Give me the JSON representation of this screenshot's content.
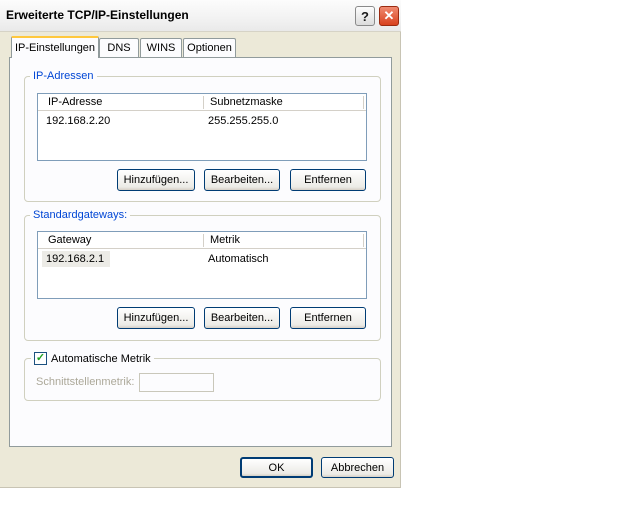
{
  "window": {
    "title": "Erweiterte TCP/IP-Einstellungen",
    "help_label": "?",
    "close_label": "✕"
  },
  "tabs": [
    {
      "label": "IP-Einstellungen",
      "active": true
    },
    {
      "label": "DNS",
      "active": false
    },
    {
      "label": "WINS",
      "active": false
    },
    {
      "label": "Optionen",
      "active": false
    }
  ],
  "ip_group": {
    "legend": "IP-Adressen",
    "columns": [
      "IP-Adresse",
      "Subnetzmaske"
    ],
    "rows": [
      {
        "ip": "192.168.2.20",
        "mask": "255.255.255.0"
      }
    ],
    "buttons": {
      "add": "Hinzufügen...",
      "edit": "Bearbeiten...",
      "remove": "Entfernen"
    }
  },
  "gateway_group": {
    "legend": "Standardgateways:",
    "columns": [
      "Gateway",
      "Metrik"
    ],
    "rows": [
      {
        "gateway": "192.168.2.1",
        "metric": "Automatisch"
      }
    ],
    "buttons": {
      "add": "Hinzufügen...",
      "edit": "Bearbeiten...",
      "remove": "Entfernen"
    }
  },
  "metric_group": {
    "checkbox_label": "Automatische Metrik",
    "checked": true,
    "interface_metric_label": "Schnittstellenmetrik:",
    "interface_metric_value": ""
  },
  "footer": {
    "ok_label": "OK",
    "cancel_label": "Abbrechen"
  },
  "colors": {
    "accent": "#0046d5",
    "tab_highlight": "#ffc83c",
    "close_button": "#d8411e"
  }
}
